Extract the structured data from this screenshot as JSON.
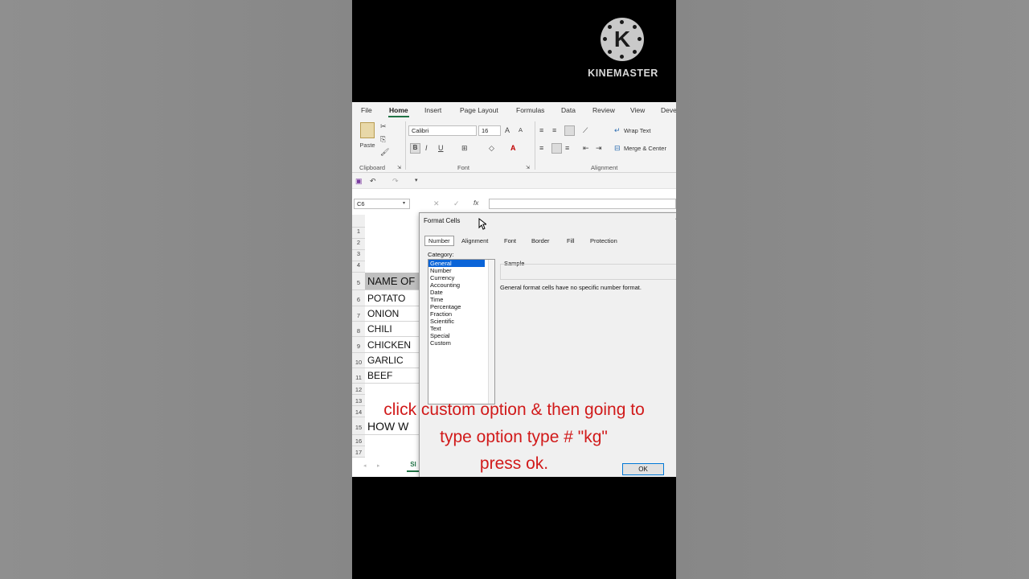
{
  "branding": {
    "name": "KINEMASTER",
    "logo_letter": "K"
  },
  "menu": [
    "File",
    "Home",
    "Insert",
    "Page Layout",
    "Formulas",
    "Data",
    "Review",
    "View",
    "Deve"
  ],
  "ribbon": {
    "paste_label": "Paste",
    "font_name": "Calibri",
    "font_size": "16",
    "wrap_text": "Wrap Text",
    "merge_center": "Merge & Center",
    "groups": {
      "clipboard": "Clipboard",
      "font": "Font",
      "alignment": "Alignment"
    },
    "bold": "B",
    "italic": "I",
    "underline": "U"
  },
  "name_box": "C6",
  "fx": "fx",
  "rows": [
    {
      "num": "1",
      "value": ""
    },
    {
      "num": "2",
      "value": ""
    },
    {
      "num": "3",
      "value": ""
    },
    {
      "num": "4",
      "value": ""
    },
    {
      "num": "5",
      "value": "NAME OF"
    },
    {
      "num": "6",
      "value": "POTATO"
    },
    {
      "num": "7",
      "value": "ONION"
    },
    {
      "num": "8",
      "value": "CHILI"
    },
    {
      "num": "9",
      "value": "CHICKEN"
    },
    {
      "num": "10",
      "value": "GARLIC"
    },
    {
      "num": "11",
      "value": "BEEF"
    },
    {
      "num": "12",
      "value": ""
    },
    {
      "num": "13",
      "value": ""
    },
    {
      "num": "14",
      "value": ""
    },
    {
      "num": "15",
      "value": "HOW W"
    },
    {
      "num": "16",
      "value": ""
    },
    {
      "num": "17",
      "value": ""
    }
  ],
  "sheet_tab": "Sl",
  "dialog": {
    "title": "Format Cells",
    "tabs": [
      "Number",
      "Alignment",
      "Font",
      "Border",
      "Fill",
      "Protection"
    ],
    "category_label": "Category:",
    "categories": [
      "General",
      "Number",
      "Currency",
      "Accounting",
      "Date",
      "Time",
      "Percentage",
      "Fraction",
      "Scientific",
      "Text",
      "Special",
      "Custom"
    ],
    "selected_category": "General",
    "sample_label": "Sample",
    "description": "General format cells have no specific number format.",
    "ok_label": "OK"
  },
  "caption": {
    "line1": "click custom option & then going to",
    "line2": "type option type # \"kg\"",
    "line3": "press ok."
  },
  "colors": {
    "accent": "#217346",
    "caption": "#d11a1a",
    "selection": "#0a64d8"
  }
}
